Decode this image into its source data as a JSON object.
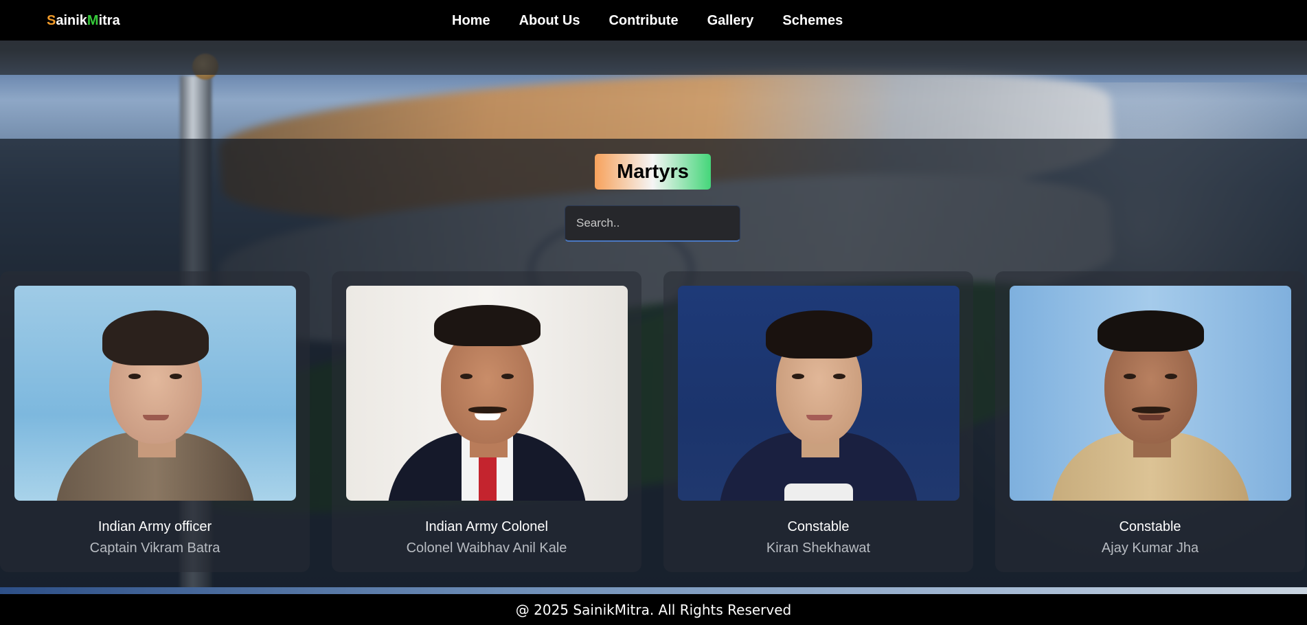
{
  "brand": {
    "first": "S",
    "mid1": "ainik",
    "m": "M",
    "rest": "itra"
  },
  "nav": {
    "items": [
      {
        "label": "Home"
      },
      {
        "label": "About Us"
      },
      {
        "label": "Contribute"
      },
      {
        "label": "Gallery"
      },
      {
        "label": "Schemes"
      }
    ]
  },
  "page": {
    "title": "Martyrs",
    "search_placeholder": "Search.."
  },
  "cards": [
    {
      "role": "Indian Army officer",
      "name": "Captain Vikram Batra"
    },
    {
      "role": "Indian Army Colonel",
      "name": "Colonel Waibhav Anil Kale"
    },
    {
      "role": "Constable",
      "name": "Kiran Shekhawat"
    },
    {
      "role": "Constable",
      "name": "Ajay Kumar Jha"
    }
  ],
  "footer": {
    "text": "@ 2025 SainikMitra. All Rights Reserved"
  },
  "colors": {
    "brand_s": "#f29b2a",
    "brand_m": "#36c93a",
    "title_gradient_start": "#f7a25c",
    "title_gradient_end": "#45d67a"
  }
}
